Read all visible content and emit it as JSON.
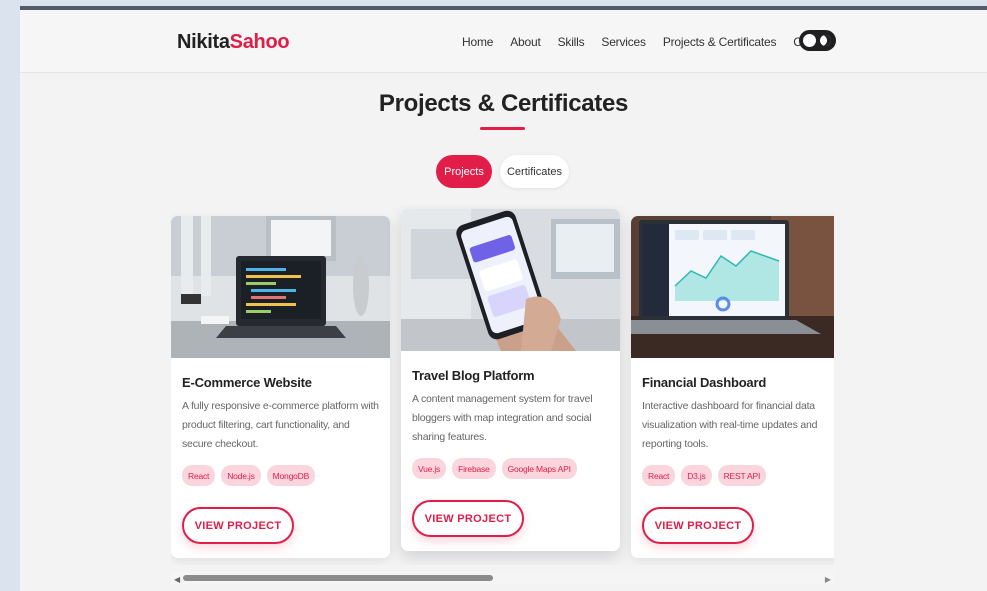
{
  "brand": {
    "first": "Nikita",
    "second": "Sahoo"
  },
  "nav": {
    "items": [
      {
        "label": "Home"
      },
      {
        "label": "About"
      },
      {
        "label": "Skills"
      },
      {
        "label": "Services"
      },
      {
        "label": "Projects & Certificates"
      },
      {
        "label": "Contact"
      }
    ],
    "theme_toggle": "dark-mode-toggle"
  },
  "section": {
    "title": "Projects & Certificates",
    "tabs": [
      {
        "label": "Projects",
        "active": true
      },
      {
        "label": "Certificates",
        "active": false
      }
    ]
  },
  "projects": [
    {
      "title": "E-Commerce Website",
      "description": "A fully responsive e-commerce platform with product filtering, cart functionality, and secure checkout.",
      "tags": [
        "React",
        "Node.js",
        "MongoDB"
      ],
      "button": "VIEW PROJECT"
    },
    {
      "title": "Travel Blog Platform",
      "description": "A content management system for travel bloggers with map integration and social sharing features.",
      "tags": [
        "Vue.js",
        "Firebase",
        "Google Maps API"
      ],
      "button": "VIEW PROJECT"
    },
    {
      "title": "Financial Dashboard",
      "description": "Interactive dashboard for financial data visualization with real-time updates and reporting tools.",
      "tags": [
        "React",
        "D3.js",
        "REST API"
      ],
      "button": "VIEW PROJECT"
    }
  ],
  "colors": {
    "accent": "#e11d48",
    "tag_bg": "#fbd5de"
  }
}
